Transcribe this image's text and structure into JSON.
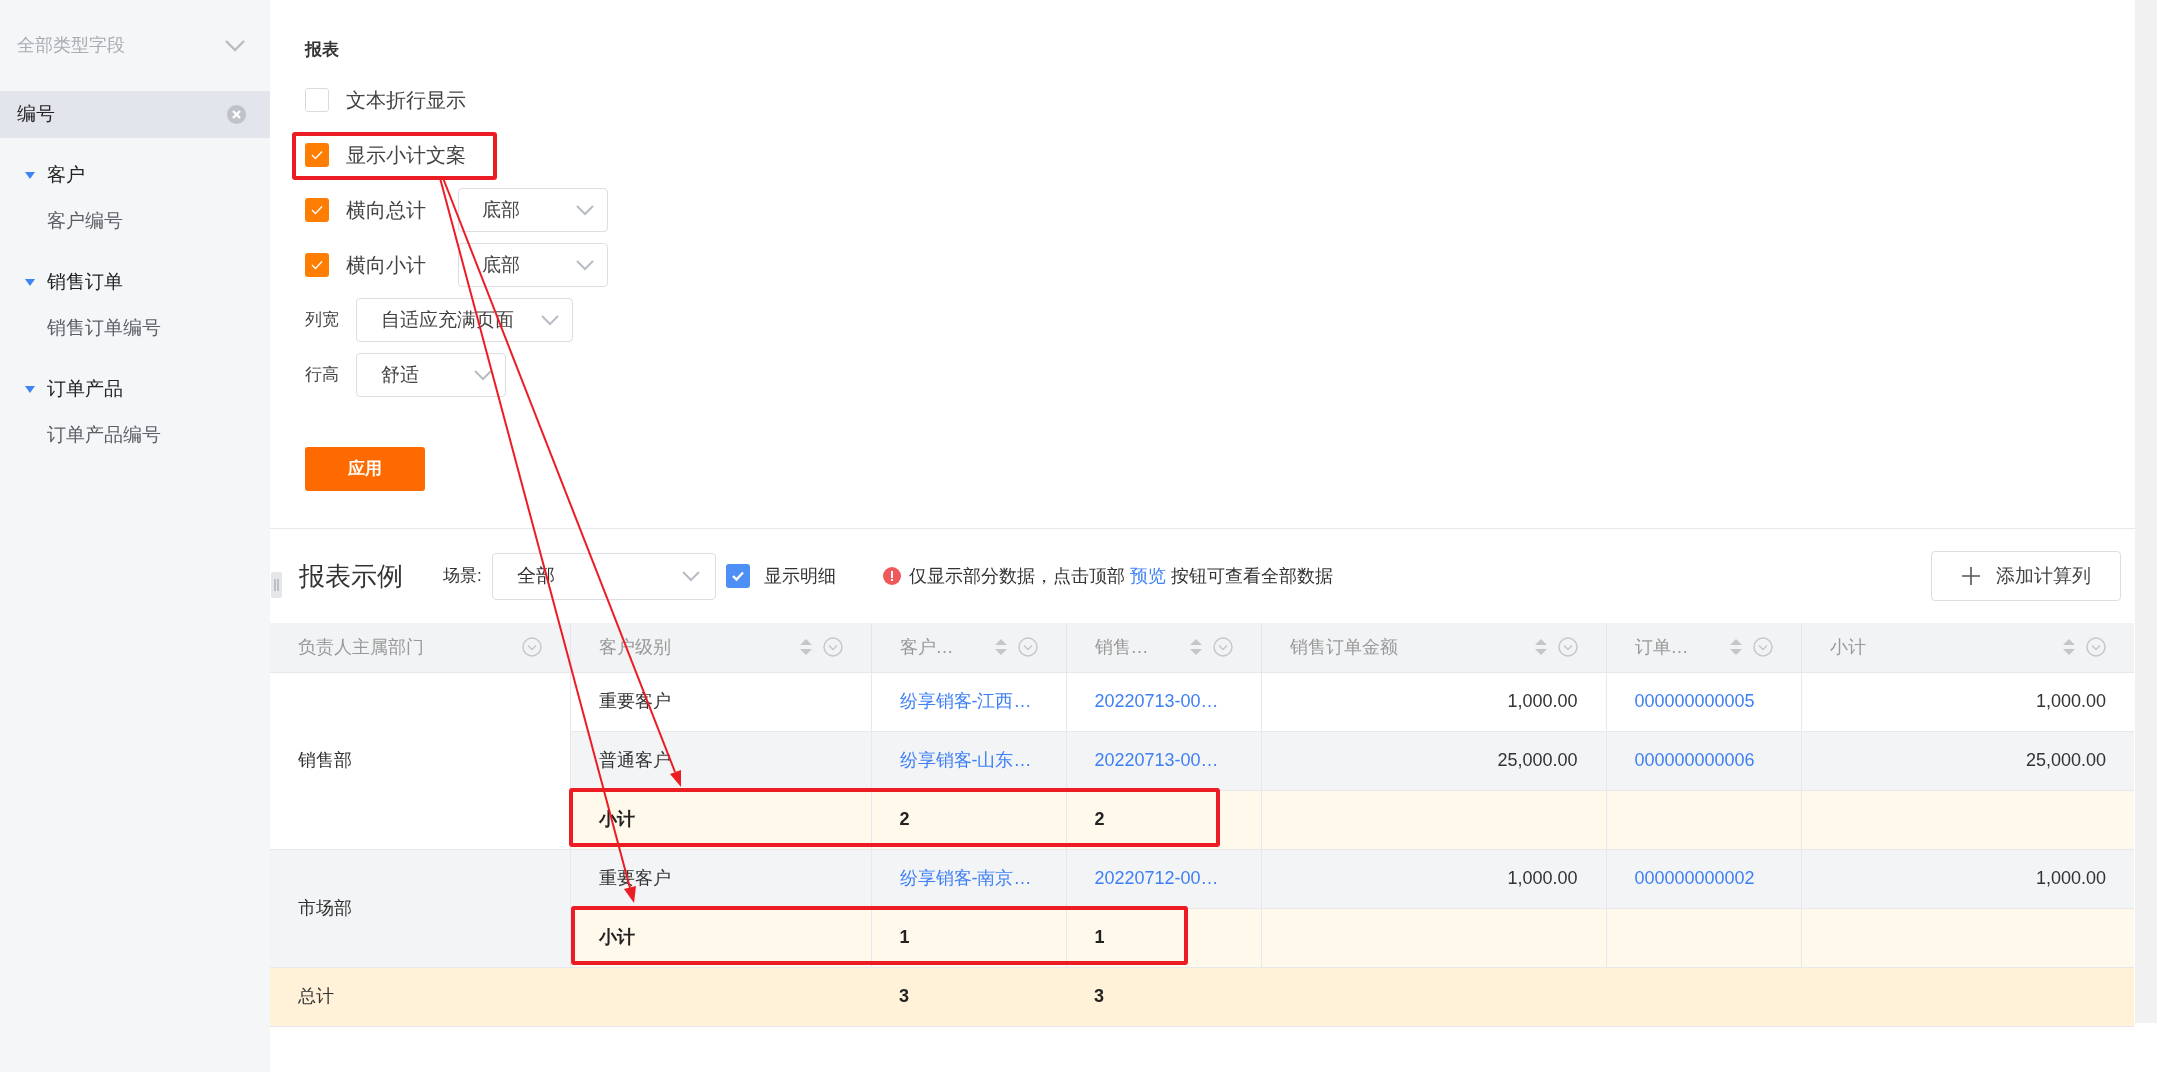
{
  "sidebar": {
    "filter": {
      "label": "全部类型字段"
    },
    "selected_field": {
      "label": "编号"
    },
    "groups": [
      {
        "label": "客户",
        "expanded": true,
        "children": [
          {
            "label": "客户编号"
          }
        ]
      },
      {
        "label": "销售订单",
        "expanded": true,
        "children": [
          {
            "label": "销售订单编号"
          }
        ]
      },
      {
        "label": "订单产品",
        "expanded": true,
        "children": [
          {
            "label": "订单产品编号"
          }
        ]
      }
    ]
  },
  "settings": {
    "title": "报表",
    "options": [
      {
        "label": "文本折行显示",
        "checked": false
      },
      {
        "label": "显示小计文案",
        "checked": true
      },
      {
        "label": "横向总计",
        "checked": true,
        "select": "底部"
      },
      {
        "label": "横向小计",
        "checked": true,
        "select": "底部"
      }
    ],
    "fields": [
      {
        "label": "列宽",
        "value": "自适应充满页面"
      },
      {
        "label": "行高",
        "value": "舒适"
      }
    ],
    "apply_button": "应用"
  },
  "preview": {
    "title": "报表示例",
    "scene_label": "场景:",
    "scene_value": "全部",
    "show_detail": {
      "label": "显示明细",
      "checked": true
    },
    "notice": {
      "before": "仅显示部分数据，点击顶部 ",
      "link": "预览",
      "after": " 按钮可查看全部数据"
    },
    "add_button": "添加计算列"
  },
  "table": {
    "columns": [
      {
        "label": "负责人主属部门",
        "kind": "text",
        "sortable": false
      },
      {
        "label": "客户级别",
        "kind": "text",
        "sortable": true
      },
      {
        "label": "客户…",
        "kind": "link",
        "sortable": true
      },
      {
        "label": "销售…",
        "kind": "link",
        "sortable": true
      },
      {
        "label": "销售订单金额",
        "kind": "number",
        "sortable": true
      },
      {
        "label": "订单…",
        "kind": "link",
        "sortable": true
      },
      {
        "label": "小计",
        "kind": "number",
        "sortable": true
      }
    ],
    "groups": [
      {
        "department": "销售部",
        "shaded": false,
        "rows": [
          {
            "kind": "detail",
            "shaded": false,
            "cells": [
              "重要客户",
              "纷享销客-江西…",
              "20220713-00…",
              "1,000.00",
              "000000000005",
              "1,000.00"
            ]
          },
          {
            "kind": "detail",
            "shaded": true,
            "cells": [
              "普通客户",
              "纷享销客-山东…",
              "20220713-00…",
              "25,000.00",
              "000000000006",
              "25,000.00"
            ]
          },
          {
            "kind": "subtotal",
            "cells": [
              "小计",
              "2",
              "2",
              null,
              null,
              null
            ]
          }
        ]
      },
      {
        "department": "市场部",
        "shaded": true,
        "rows": [
          {
            "kind": "detail",
            "shaded": true,
            "cells": [
              "重要客户",
              "纷享销客-南京…",
              "20220712-00…",
              "1,000.00",
              "000000000002",
              "1,000.00"
            ]
          },
          {
            "kind": "subtotal",
            "cells": [
              "小计",
              "1",
              "1",
              null,
              null,
              null
            ]
          }
        ]
      }
    ],
    "total": {
      "label": "总计",
      "cells": [
        null,
        "3",
        "3",
        null,
        null,
        null
      ]
    }
  }
}
